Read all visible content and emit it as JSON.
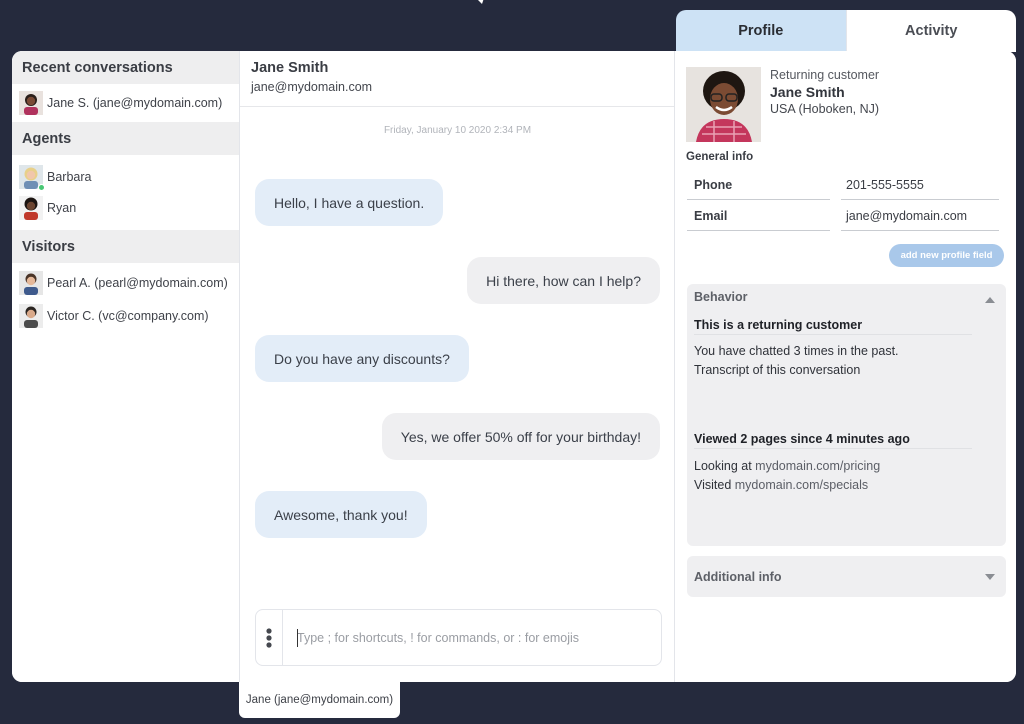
{
  "sidebar": {
    "recent_heading": "Recent conversations",
    "recent": [
      {
        "label": "Jane S. (jane@mydomain.com)"
      }
    ],
    "agents_heading": "Agents",
    "agents": [
      {
        "label": "Barbara",
        "status": "online"
      },
      {
        "label": "Ryan"
      }
    ],
    "visitors_heading": "Visitors",
    "visitors": [
      {
        "label": "Pearl A. (pearl@mydomain.com)"
      },
      {
        "label": "Victor C. (vc@company.com)"
      }
    ]
  },
  "chat": {
    "contact_name": "Jane Smith",
    "contact_email": "jane@mydomain.com",
    "timestamp": "Friday, January 10 2020 2:34 PM",
    "messages": [
      {
        "direction": "in",
        "text": "Hello, I have a question."
      },
      {
        "direction": "out",
        "text": "Hi there, how can I help?"
      },
      {
        "direction": "in",
        "text": "Do you have any discounts?"
      },
      {
        "direction": "out",
        "text": "Yes, we offer 50% off for your birthday!"
      },
      {
        "direction": "in",
        "text": "Awesome, thank you!"
      }
    ],
    "composer_placeholder": "Type ; for shortcuts, ! for commands, or : for emojis"
  },
  "tabs": [
    {
      "label": "Profile",
      "active": true
    },
    {
      "label": "Activity",
      "active": false
    }
  ],
  "profile": {
    "tag": "Returning customer",
    "name": "Jane Smith",
    "location": "USA (Hoboken, NJ)",
    "general_info_heading": "General info",
    "fields": [
      {
        "label": "Phone",
        "value": "201-555-5555"
      },
      {
        "label": "Email",
        "value": "jane@mydomain.com"
      }
    ],
    "add_field_button": "add new profile field",
    "behavior": {
      "title": "Behavior",
      "heading1": "This is a returning customer",
      "line1": "You have chatted 3 times in the past.",
      "line2": "Transcript of this conversation",
      "heading2": "Viewed 2 pages since 4 minutes ago",
      "looking_prefix": "Looking at ",
      "looking_link": "mydomain.com/pricing",
      "visited_prefix": "Visited ",
      "visited_link": "mydomain.com/specials"
    },
    "additional_title": "Additional info"
  },
  "bottom_tag": "Jane (jane@mydomain.com)",
  "colors": {
    "background": "#252a3d",
    "incoming_bubble": "#e3edf8",
    "outgoing_bubble": "#efeff1",
    "active_tab": "#cde2f5",
    "add_field_button": "#a9c8ea",
    "online": "#48c774"
  }
}
